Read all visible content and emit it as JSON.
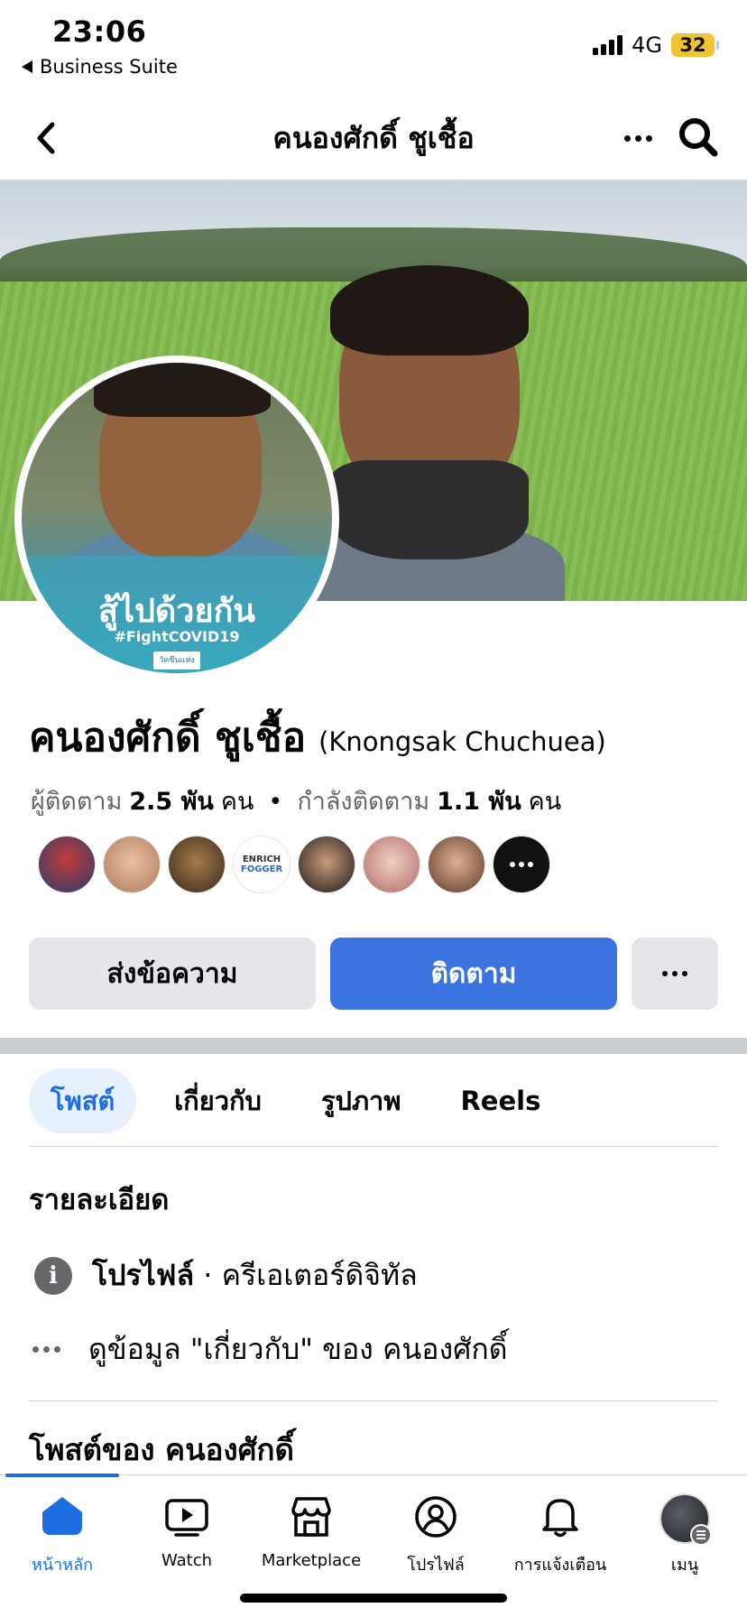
{
  "status_bar": {
    "time": "23:06",
    "back_app": "Business Suite",
    "network": "4G",
    "battery": "32"
  },
  "header": {
    "title": "คนองศักดิ์ ชูเชื้อ",
    "back_icon": "chevron-left-icon",
    "more_icon": "more-horizontal-icon",
    "search_icon": "search-icon"
  },
  "profile": {
    "name": "คนองศักดิ์ ชูเชื้อ",
    "alt_name": "(Knongsak Chuchuea)",
    "avatar_slogan": "สู้ไปด้วยกัน",
    "avatar_hashtag": "#FightCOVID19",
    "avatar_logo": "วัคซีนแห่งชาติ",
    "followers_label": "ผู้ติดตาม",
    "followers_count": "2.5 พัน",
    "followers_unit": "คน",
    "following_label": "กำลังติดตาม",
    "following_count": "1.1 พัน",
    "following_unit": "คน"
  },
  "friend_avatars": {
    "enrich_line1": "ENRICH",
    "enrich_line2": "FOGGER"
  },
  "actions": {
    "message": "ส่งข้อความ",
    "follow": "ติดตาม"
  },
  "tabs": [
    {
      "label": "โพสต์",
      "active": true
    },
    {
      "label": "เกี่ยวกับ"
    },
    {
      "label": "รูปภาพ"
    },
    {
      "label": "Reels"
    }
  ],
  "details": {
    "title": "รายละเอียด",
    "profile_label": "โปรไฟล์",
    "separator": "·",
    "profile_category": "ครีเอเตอร์ดิจิทัล",
    "about_link": "ดูข้อมูล \"เกี่ยวกับ\" ของ คนองศักดิ์"
  },
  "posts": {
    "title": "โพสต์ของ คนองศักดิ์"
  },
  "tabbar": [
    {
      "label": "หน้าหลัก",
      "icon": "home-icon",
      "active": true
    },
    {
      "label": "Watch",
      "icon": "watch-icon"
    },
    {
      "label": "Marketplace",
      "icon": "marketplace-icon"
    },
    {
      "label": "โปรไฟล์",
      "icon": "profile-icon"
    },
    {
      "label": "การแจ้งเตือน",
      "icon": "bell-icon"
    },
    {
      "label": "เมนู",
      "icon": "menu-avatar-icon"
    }
  ],
  "colors": {
    "accent": "#1d6fe0",
    "follow_button": "#3b73e0",
    "secondary_button": "#e4e6eb",
    "battery": "#f2c230"
  }
}
